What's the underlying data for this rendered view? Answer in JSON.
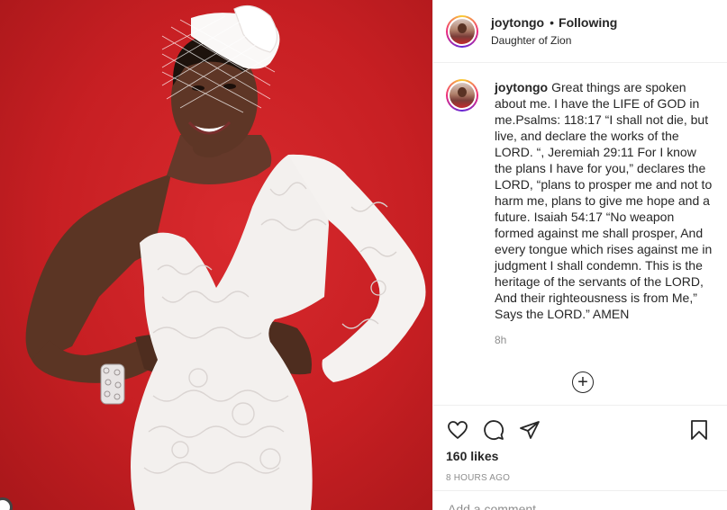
{
  "post": {
    "username": "joytongo",
    "follow_status": "Following",
    "separator": "•",
    "location_subtitle": "Daughter of Zion",
    "caption": "Great things are spoken about me. I have the LIFE of GOD in me.Psalms: 118:17 “I shall not die, but live, and declare the works of the LORD. “, Jeremiah 29:11 For I know the plans I have for you,” declares the LORD, “plans to prosper me and not to harm me, plans to give me hope and a future. Isaiah 54:17 “No weapon formed against me shall prosper, And every tongue which rises against me in judgment I shall condemn. This is the heritage of the servants of the LORD, And their righteousness is from Me,” Says the LORD.” AMEN",
    "caption_time": "8h",
    "likes": "160 likes",
    "posted_ago": "8 HOURS AGO",
    "add_comment_placeholder": "Add a comment…"
  },
  "icons": {
    "like": "heart-icon",
    "comment": "speech-bubble-icon",
    "share": "paper-plane-icon",
    "save": "bookmark-icon",
    "load_more": "plus-circle-icon"
  },
  "colors": {
    "photo_background": "#c71f23",
    "text_primary": "#262626",
    "text_secondary": "#8e8e8e",
    "divider": "#efefef"
  }
}
